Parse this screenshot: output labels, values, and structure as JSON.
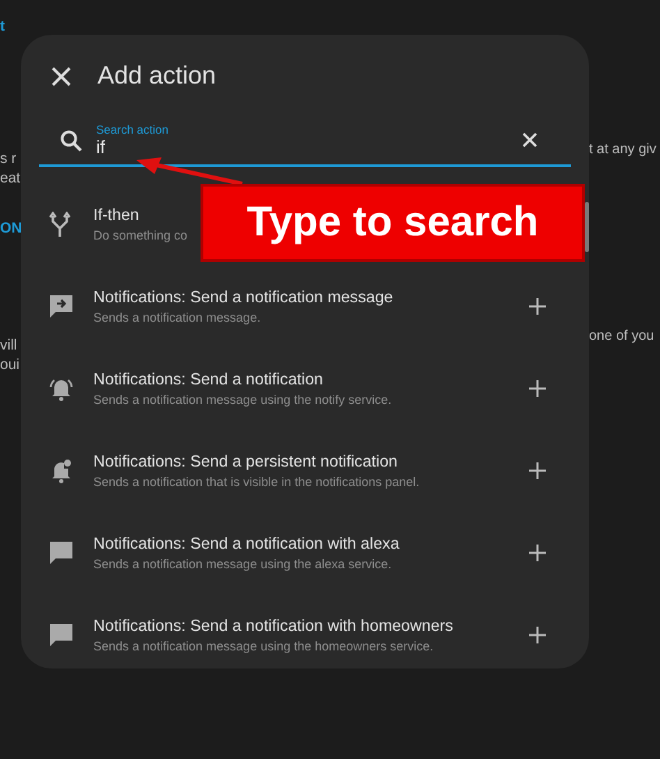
{
  "background_text": {
    "left": [
      {
        "text": "t",
        "kind": "link"
      },
      {
        "text": "s r",
        "kind": "plain"
      },
      {
        "text": "eat",
        "kind": "plain"
      },
      {
        "text": "ON",
        "kind": "link"
      },
      {
        "text": "vill",
        "kind": "plain"
      },
      {
        "text": "oui",
        "kind": "plain"
      }
    ],
    "right": [
      {
        "text": "t at any giv"
      },
      {
        "text": "one of you"
      }
    ]
  },
  "dialog": {
    "title": "Add action",
    "search": {
      "label": "Search action",
      "value": "if"
    },
    "actions": [
      {
        "title": "If-then",
        "description": "Do something co"
      },
      {
        "title": "Notifications: Send a notification message",
        "description": "Sends a notification message."
      },
      {
        "title": "Notifications: Send a notification",
        "description": "Sends a notification message using the notify service."
      },
      {
        "title": "Notifications: Send a persistent notification",
        "description": "Sends a notification that is visible in the notifications panel."
      },
      {
        "title": "Notifications: Send a notification with alexa",
        "description": "Sends a notification message using the alexa service."
      },
      {
        "title": "Notifications: Send a notification with homeowners",
        "description": "Sends a notification message using the homeowners service."
      }
    ]
  },
  "annotation": {
    "text": "Type to search"
  }
}
